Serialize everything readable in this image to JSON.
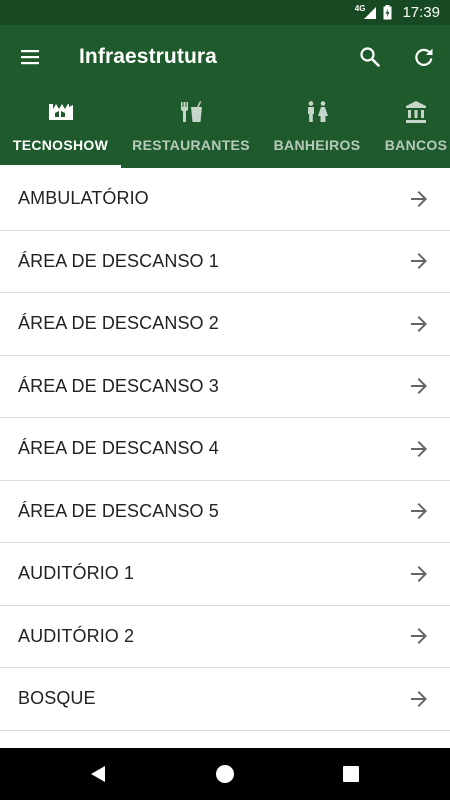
{
  "status_bar": {
    "network": "4G",
    "time": "17:39"
  },
  "toolbar": {
    "title": "Infraestrutura",
    "menu_icon": "menu-icon",
    "search_icon": "search-icon",
    "refresh_icon": "refresh-icon"
  },
  "tabs": [
    {
      "label": "TECNOSHOW",
      "icon": "tecnoshow-icon",
      "active": true
    },
    {
      "label": "RESTAURANTES",
      "icon": "restaurant-icon",
      "active": false
    },
    {
      "label": "BANHEIROS",
      "icon": "restroom-icon",
      "active": false
    },
    {
      "label": "BANCOS",
      "icon": "bank-icon",
      "active": false
    }
  ],
  "list": {
    "items": [
      {
        "label": "AMBULATÓRIO"
      },
      {
        "label": "ÁREA DE DESCANSO 1"
      },
      {
        "label": "ÁREA DE DESCANSO 2"
      },
      {
        "label": "ÁREA DE DESCANSO 3"
      },
      {
        "label": "ÁREA DE DESCANSO 4"
      },
      {
        "label": "ÁREA DE DESCANSO 5"
      },
      {
        "label": "AUDITÓRIO 1"
      },
      {
        "label": "AUDITÓRIO 2"
      },
      {
        "label": "BOSQUE"
      }
    ],
    "item_icon": "arrow-right-icon"
  },
  "colors": {
    "status_bar": "#174a22",
    "app_bar": "#1e5a2b",
    "indicator": "#ffffff",
    "arrow": "#666666"
  },
  "nav_bar": {
    "back_icon": "back-icon",
    "home_icon": "home-icon",
    "recents_icon": "recents-icon"
  }
}
